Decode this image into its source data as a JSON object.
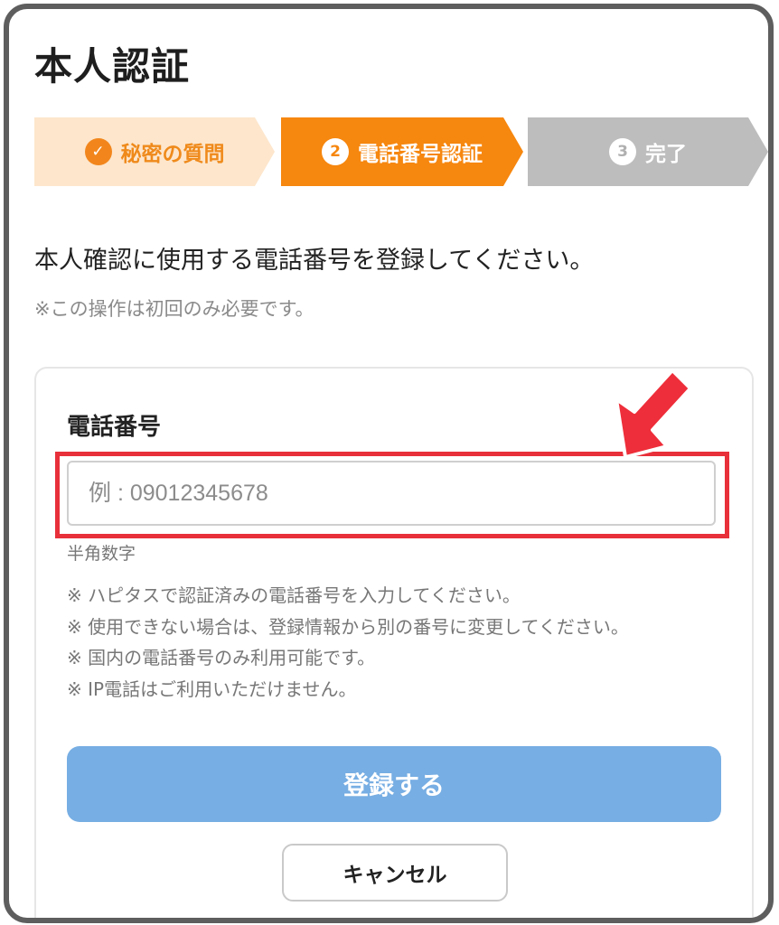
{
  "page": {
    "title": "本人認証"
  },
  "stepper": {
    "steps": [
      {
        "icon": "✓",
        "label": "秘密の質問",
        "state": "done"
      },
      {
        "icon": "2",
        "label": "電話番号認証",
        "state": "current"
      },
      {
        "icon": "3",
        "label": "完了",
        "state": "upcoming"
      }
    ]
  },
  "intro": {
    "instruction": "本人確認に使用する電話番号を登録してください。",
    "note": "※この操作は初回のみ必要です。"
  },
  "form": {
    "phone_label": "電話番号",
    "phone_value": "",
    "phone_placeholder": "例 : 09012345678",
    "hint": "半角数字",
    "notes": [
      "※ ハピタスで認証済みの電話番号を入力してください。",
      "※ 使用できない場合は、登録情報から別の番号に変更してください。",
      "※ 国内の電話番号のみ利用可能です。",
      "※ IP電話はご利用いただけません。"
    ],
    "submit_label": "登録する",
    "cancel_label": "キャンセル"
  },
  "annotation": {
    "arrow_icon": "red-arrow-icon",
    "highlight_color": "#e8303a"
  },
  "colors": {
    "step_done_bg": "#fde6cc",
    "step_current_bg": "#f6870f",
    "step_upcoming_bg": "#bdbdbd",
    "submit_button_bg": "#77aee3"
  }
}
